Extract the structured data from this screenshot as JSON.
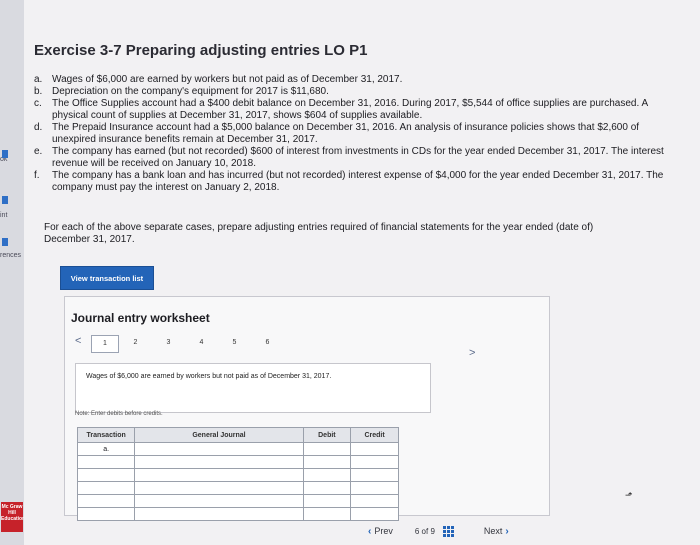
{
  "sidebar": {
    "marks": [
      {
        "text": "ok"
      },
      {
        "text": "int"
      },
      {
        "text": "rences"
      }
    ],
    "logo_text": "Mc Graw Hill Education"
  },
  "exercise": {
    "title": "Exercise 3-7 Preparing adjusting entries LO P1",
    "items": [
      {
        "letter": "a.",
        "text": "Wages of $6,000 are earned by workers but not paid as of December 31, 2017."
      },
      {
        "letter": "b.",
        "text": "Depreciation on the company's equipment for 2017 is $11,680."
      },
      {
        "letter": "c.",
        "text": "The Office Supplies account had a $400 debit balance on December 31, 2016. During 2017, $5,544 of office supplies are purchased. A physical count of supplies at December 31, 2017, shows $604 of supplies available."
      },
      {
        "letter": "d.",
        "text": "The Prepaid Insurance account had a $5,000 balance on December 31, 2016. An analysis of insurance policies shows that $2,600 of unexpired insurance benefits remain at December 31, 2017."
      },
      {
        "letter": "e.",
        "text": "The company has earned (but not recorded) $600 of interest from investments in CDs for the year ended December 31, 2017. The interest revenue will be received on January 10, 2018."
      },
      {
        "letter": "f.",
        "text": "The company has a bank loan and has incurred (but not recorded) interest expense of $4,000 for the year ended December 31, 2017. The company must pay the interest on January 2, 2018."
      }
    ],
    "instruction": "For each of the above separate cases, prepare adjusting entries required of financial statements for the year ended (date of) December 31, 2017."
  },
  "view_button_label": "View transaction list",
  "worksheet": {
    "title": "Journal entry worksheet",
    "prev_chevron": "<",
    "next_chevron": ">",
    "pages": [
      "1",
      "2",
      "3",
      "4",
      "5",
      "6"
    ],
    "active_page": "1",
    "description": "Wages of $6,000 are earned by workers but not paid as of December 31, 2017.",
    "note": "Note: Enter debits before credits.",
    "table": {
      "headers": [
        "Transaction",
        "General Journal",
        "Debit",
        "Credit"
      ],
      "rows": [
        [
          "a.",
          "",
          "",
          ""
        ],
        [
          "",
          "",
          "",
          ""
        ],
        [
          "",
          "",
          "",
          ""
        ],
        [
          "",
          "",
          "",
          ""
        ],
        [
          "",
          "",
          "",
          ""
        ],
        [
          "",
          "",
          "",
          ""
        ]
      ]
    }
  },
  "bottom_nav": {
    "prev_label": "Prev",
    "page_current": "6",
    "page_of": "of",
    "page_total": "9",
    "next_label": "Next",
    "prev_icon": "chevron-left-icon",
    "next_icon": "chevron-right-icon",
    "grid_icon": "grid-icon"
  },
  "colors": {
    "accent": "#2364b8",
    "brand": "#c6222a"
  }
}
